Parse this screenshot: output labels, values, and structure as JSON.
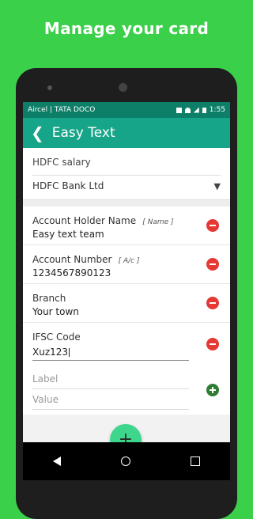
{
  "headline": "Manage your card",
  "status_bar": {
    "carrier": "Aircel | TATA DOCO",
    "time": "1:55"
  },
  "app_bar": {
    "title": "Easy Text"
  },
  "card": {
    "name": "HDFC salary",
    "bank": "HDFC Bank Ltd"
  },
  "fields": [
    {
      "label": "Account Holder Name",
      "hint": "[ Name ]",
      "value": "Easy text team"
    },
    {
      "label": "Account Number",
      "hint": "[ A/c ]",
      "value": "1234567890123"
    },
    {
      "label": "Branch",
      "hint": "",
      "value": "Your town"
    },
    {
      "label": "IFSC Code",
      "hint": "",
      "value": "Xuz123"
    }
  ],
  "new_field": {
    "label_placeholder": "Label",
    "value_placeholder": "Value"
  },
  "fab": {
    "symbol": "+"
  },
  "icons": {
    "back": "arrow-left-icon",
    "remove": "minus-circle-icon",
    "add": "plus-circle-icon",
    "nav_back": "triangle-back-icon",
    "nav_home": "circle-home-icon",
    "nav_recent": "square-recents-icon"
  },
  "colors": {
    "background": "#3bd04a",
    "app_bar": "#17a589",
    "status_bar": "#0d7f68",
    "remove": "#e53935",
    "add": "#2e7d32",
    "fab": "#3dd68c"
  }
}
